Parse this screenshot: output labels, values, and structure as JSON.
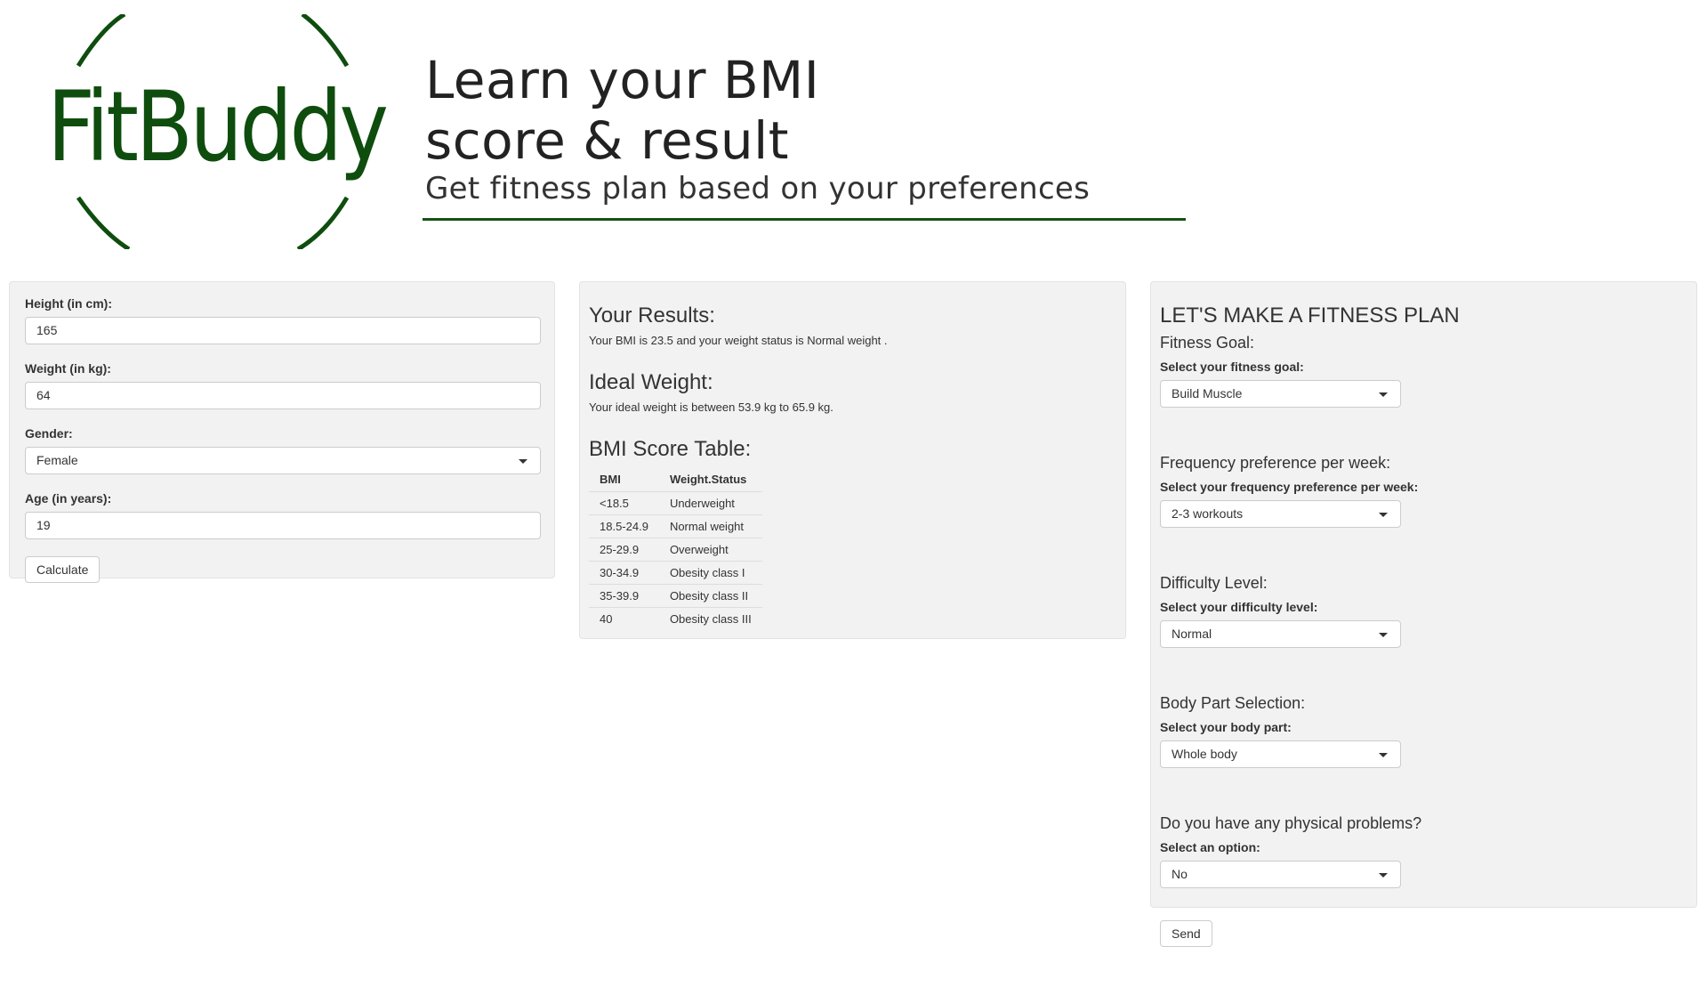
{
  "banner": {
    "logo_text": "FitBuddy",
    "headline_line1": "Learn your BMI",
    "headline_line2": "score & result",
    "subline": "Get fitness plan based on your preferences",
    "brand_color": "#0e4d0e"
  },
  "bmi_form": {
    "height_label": "Height (in cm):",
    "height_value": "165",
    "weight_label": "Weight (in kg):",
    "weight_value": "64",
    "gender_label": "Gender:",
    "gender_value": "Female",
    "age_label": "Age (in years):",
    "age_value": "19",
    "calculate_label": "Calculate"
  },
  "results": {
    "title": "Your Results:",
    "bmi_text": "Your BMI is 23.5 and your weight status is Normal weight .",
    "ideal_title": "Ideal Weight:",
    "ideal_text": "Your ideal weight is between 53.9 kg to 65.9 kg.",
    "table_title": "BMI Score Table:",
    "table_headers": [
      "BMI",
      "Weight.Status"
    ],
    "table_rows": [
      [
        "<18.5",
        "Underweight"
      ],
      [
        "18.5-24.9",
        "Normal weight"
      ],
      [
        "25-29.9",
        "Overweight"
      ],
      [
        "30-34.9",
        "Obesity class I"
      ],
      [
        "35-39.9",
        "Obesity class II"
      ],
      [
        "40",
        "Obesity class III"
      ]
    ]
  },
  "plan": {
    "title": "LET'S MAKE A FITNESS PLAN",
    "sections": [
      {
        "title": "Fitness Goal:",
        "label": "Select your fitness goal:",
        "value": "Build Muscle"
      },
      {
        "title": "Frequency preference per week:",
        "label": "Select your frequency preference per week:",
        "value": "2-3 workouts"
      },
      {
        "title": "Difficulty Level:",
        "label": "Select your difficulty level:",
        "value": "Normal"
      },
      {
        "title": "Body Part Selection:",
        "label": "Select your body part:",
        "value": "Whole body"
      },
      {
        "title": "Do you have any physical problems?",
        "label": "Select an option:",
        "value": "No"
      }
    ],
    "send_label": "Send"
  }
}
